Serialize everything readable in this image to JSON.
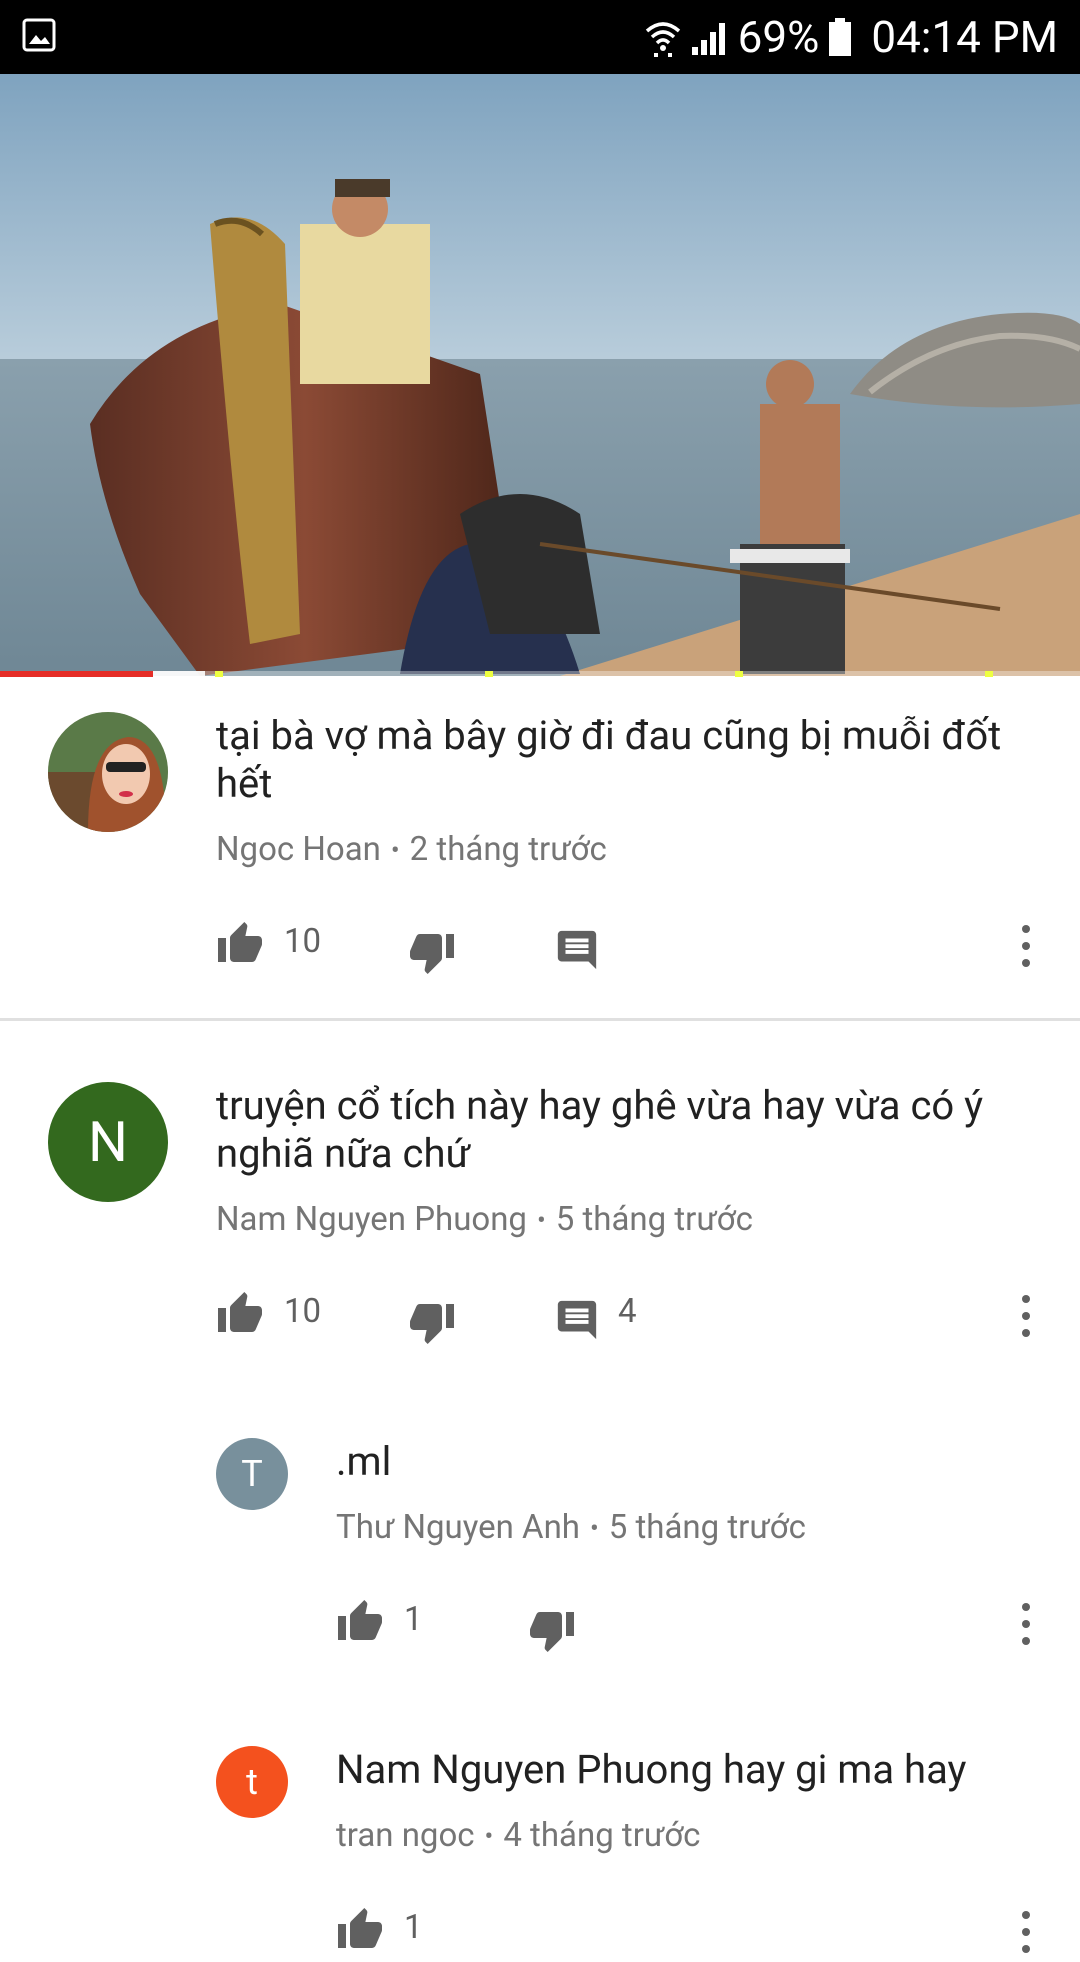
{
  "status_bar": {
    "battery": "69%",
    "time": "04:14 PM",
    "left_icon": "gallery-icon",
    "icons": [
      "wifi-icon",
      "signal-icon",
      "battery-icon"
    ]
  },
  "video": {
    "progress_fraction": 0.142,
    "buffered_fraction": 0.19
  },
  "comments": [
    {
      "author": "Ngoc Hoan",
      "time": "2 tháng trước",
      "text": "tại bà vợ mà bây giờ đi đau cũng bị muỗi đốt hết",
      "likes": "10",
      "replies": ""
    },
    {
      "author": "Nam Nguyen Phuong",
      "avatar_letter": "N",
      "avatar_color": "#33691e",
      "time": "5 tháng trước",
      "text": "truyện cổ tích này hay ghê vừa hay vừa có ý nghiã nữa chứ",
      "likes": "10",
      "replies": "4"
    }
  ],
  "replies": [
    {
      "author": "Thư Nguyen Anh",
      "avatar_letter": "T",
      "avatar_color": "#78909c",
      "time": "5 tháng trước",
      "text": ".ml",
      "likes": "1"
    },
    {
      "author": "tran ngoc",
      "avatar_letter": "t",
      "avatar_color": "#f4511e",
      "time": "4 tháng trước",
      "text": "Nam Nguyen Phuong hay gi ma hay",
      "likes": "1"
    }
  ],
  "separator": "•"
}
